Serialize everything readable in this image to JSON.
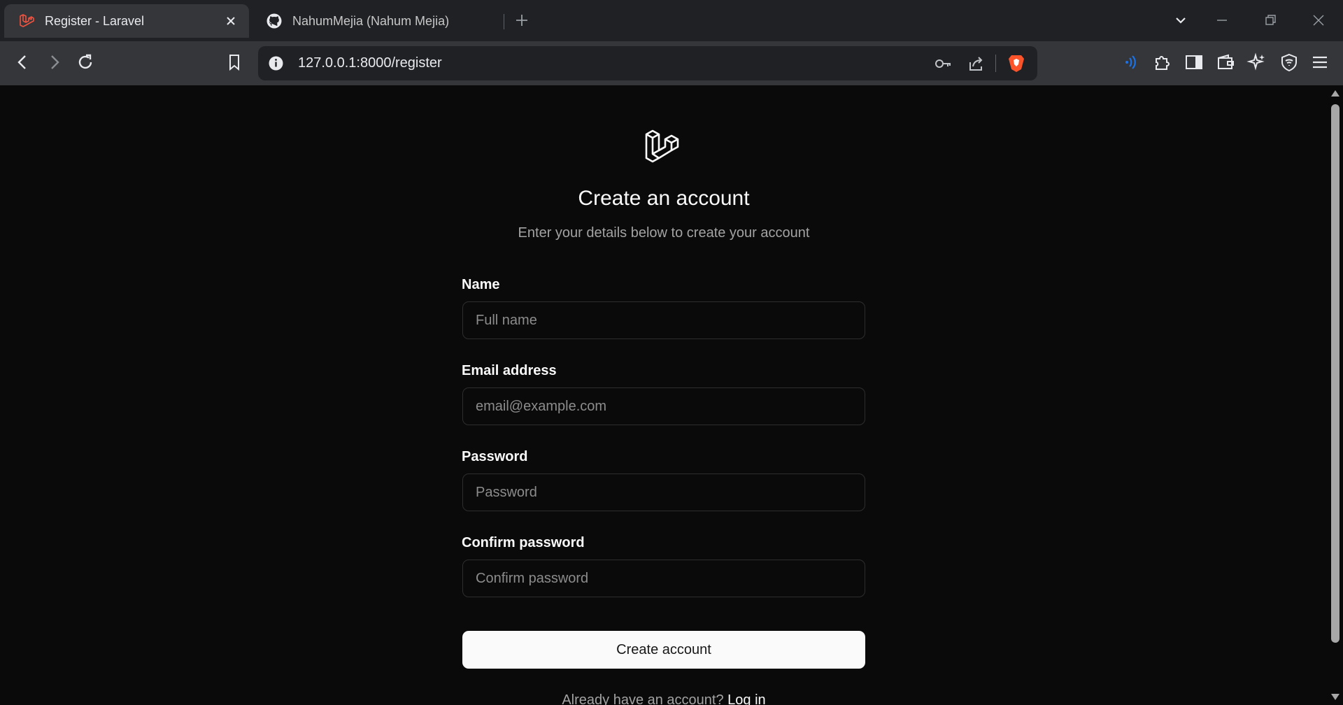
{
  "browser": {
    "tabs": [
      {
        "title": "Register - Laravel",
        "icon": "laravel-icon",
        "active": true
      },
      {
        "title": "NahumMejia (Nahum Mejia)",
        "icon": "github-icon",
        "active": false
      }
    ],
    "address_bar": {
      "url": "127.0.0.1:8000/register"
    }
  },
  "page": {
    "logo": "laravel-logo-icon",
    "title": "Create an account",
    "subtitle": "Enter your details below to create your account",
    "form": {
      "name_label": "Name",
      "name_placeholder": "Full name",
      "email_label": "Email address",
      "email_placeholder": "email@example.com",
      "password_label": "Password",
      "password_placeholder": "Password",
      "confirm_label": "Confirm password",
      "confirm_placeholder": "Confirm password",
      "submit_label": "Create account"
    },
    "footer": {
      "prompt": "Already have an account?",
      "login_link": "Log in"
    }
  },
  "colors": {
    "background": "#0a0a0a",
    "button_bg": "#fafafa",
    "input_border": "#2e2e2e",
    "muted_text": "#a3a3a3",
    "brave_accent": "#fb542b",
    "tab_favicon": "#f05340"
  }
}
